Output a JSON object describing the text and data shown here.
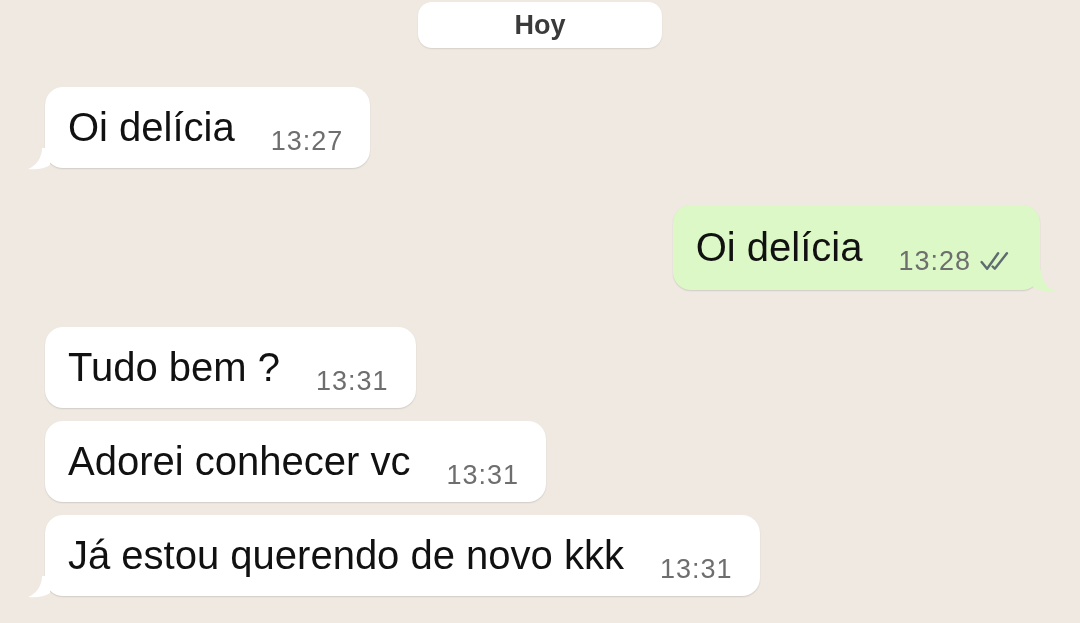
{
  "date_divider": {
    "label": "Hoy"
  },
  "messages": [
    {
      "kind": "incoming",
      "text": "Oi delícia",
      "time": "13:27",
      "tail": true
    },
    {
      "kind": "outgoing",
      "text": "Oi delícia",
      "time": "13:28",
      "tail": true,
      "read": false
    },
    {
      "kind": "incoming",
      "text": "Tudo bem ?",
      "time": "13:31",
      "tail": false
    },
    {
      "kind": "incoming",
      "text": "Adorei conhecer vc",
      "time": "13:31",
      "tail": false
    },
    {
      "kind": "incoming",
      "text": "Já estou querendo de novo kkk",
      "time": "13:31",
      "tail": true
    }
  ]
}
